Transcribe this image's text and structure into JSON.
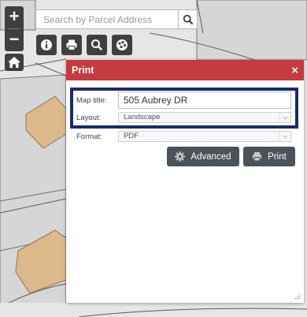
{
  "search": {
    "placeholder": "Search by Parcel Address",
    "icon": "search-icon"
  },
  "zoom": {
    "in_label": "+",
    "out_label": "−"
  },
  "toolbar": {
    "icons": [
      "info-icon",
      "print-icon",
      "search-icon",
      "layers-icon"
    ]
  },
  "print_dialog": {
    "title": "Print",
    "close_label": "×",
    "map_title_label": "Map title:",
    "map_title_value": "505 Aubrey DR",
    "layout_label": "Layout:",
    "layout_value": "Landscape",
    "format_label": "Format:",
    "format_value": "PDF",
    "advanced_label": "Advanced",
    "print_label": "Print"
  },
  "colors": {
    "header": "#c73a3f",
    "highlight_border": "#1a2b6b",
    "map_background": "#e6e6e6",
    "parcel_fill": "#ddb88a",
    "toolbar_button": "#3f3f3f",
    "dialog_button": "#4a5359"
  }
}
